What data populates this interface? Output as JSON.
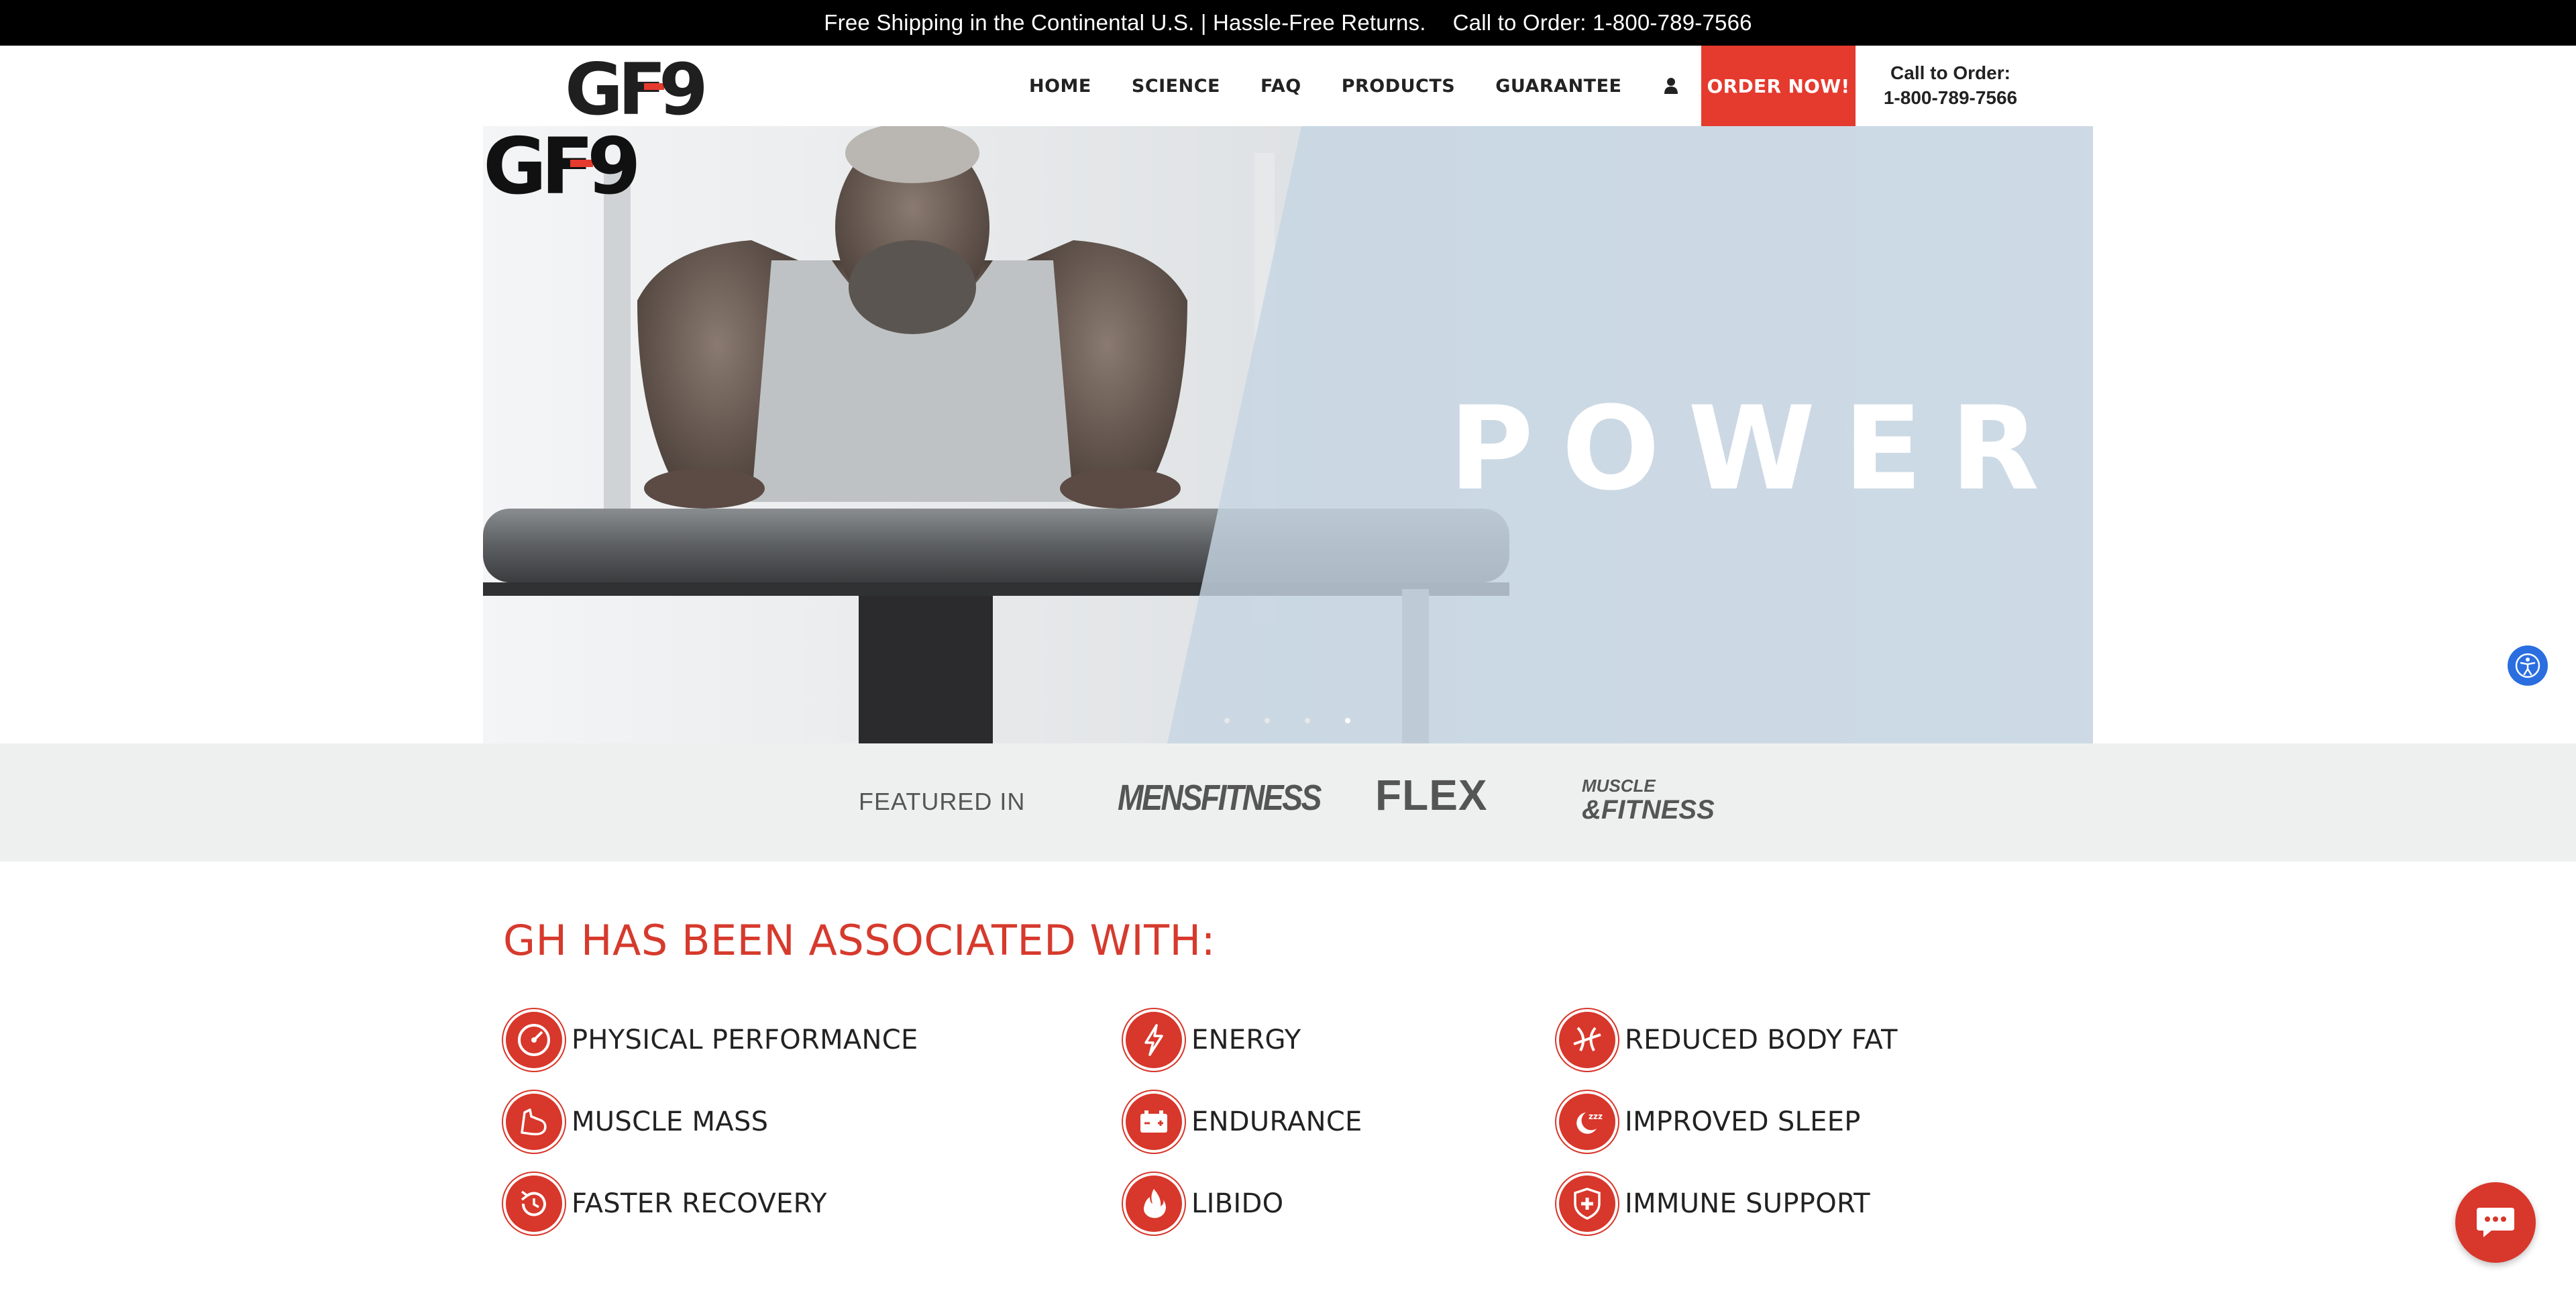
{
  "topbar": {
    "shipping": "Free Shipping in the Continental U.S. | Hassle-Free Returns.",
    "call": "Call to Order: 1-800-789-7566"
  },
  "header": {
    "logo_text": "GF-9",
    "nav": [
      "HOME",
      "SCIENCE",
      "FAQ",
      "PRODUCTS",
      "GUARANTEE"
    ],
    "account_icon": "user-icon",
    "cart_icon": "cart-icon",
    "order_button": "ORDER NOW!",
    "call_label": "Call to Order:",
    "call_number": "1-800-789-7566"
  },
  "hero": {
    "headline": "POWER",
    "logo_text": "GF-9",
    "slide_count": 4
  },
  "featured": {
    "label": "FEATURED IN",
    "publications": [
      "MENSFITNESS",
      "FLEX",
      "MUSCLE & FITNESS"
    ]
  },
  "benefits": {
    "title": "GH HAS BEEN ASSOCIATED WITH:",
    "items": [
      {
        "label": "PHYSICAL PERFORMANCE",
        "icon": "speedometer-icon"
      },
      {
        "label": "ENERGY",
        "icon": "lightning-icon"
      },
      {
        "label": "REDUCED BODY FAT",
        "icon": "tape-measure-icon"
      },
      {
        "label": "MUSCLE MASS",
        "icon": "flexed-arm-icon"
      },
      {
        "label": "ENDURANCE",
        "icon": "battery-icon"
      },
      {
        "label": "IMPROVED SLEEP",
        "icon": "moon-zzz-icon"
      },
      {
        "label": "FASTER RECOVERY",
        "icon": "clock-refresh-icon"
      },
      {
        "label": "LIBIDO",
        "icon": "flame-icon"
      },
      {
        "label": "IMMUNE SUPPORT",
        "icon": "shield-cross-icon"
      }
    ]
  },
  "colors": {
    "brand_red": "#e53a2e",
    "icon_red": "#d8372b",
    "topbar_bg": "#000000",
    "featured_bg": "#eef0f0",
    "hero_panel": "#ccd9e5",
    "accessibility_blue": "#2a6ee0"
  },
  "widgets": {
    "accessibility_icon": "accessibility-icon",
    "chat_icon": "chat-icon"
  }
}
